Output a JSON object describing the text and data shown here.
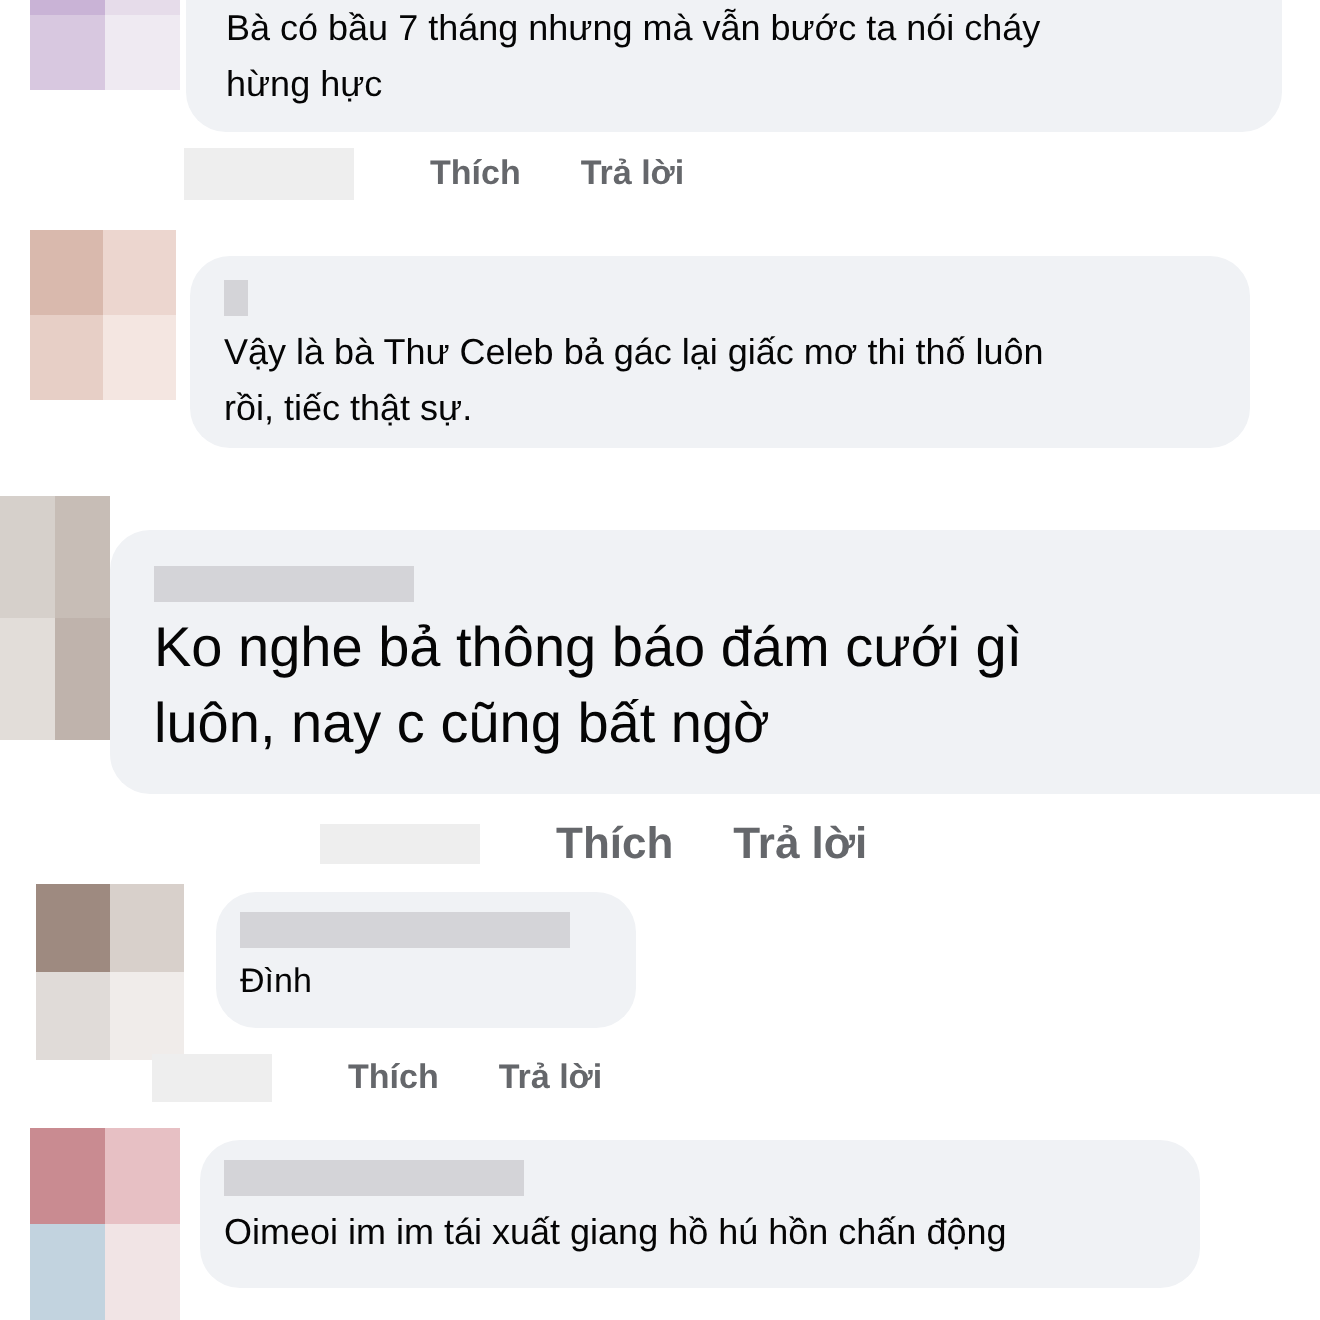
{
  "comments": [
    {
      "text": "Bà có bầu 7 tháng nhưng mà vẫn bước ta  nói cháy hừng hực",
      "actions": [
        "Thích",
        "Trả lời"
      ]
    },
    {
      "text": "Vậy là bà Thư Celeb bả gác lại giấc mơ thi thố luôn rồi, tiếc thật sự."
    },
    {
      "text": "Ko nghe bả thông báo đám cưới gì luôn, nay c cũng bất ngờ",
      "actions": [
        "Thích",
        "Trả lời"
      ]
    },
    {
      "text": "Đình",
      "actions": [
        "Thích",
        "Trả lời"
      ]
    },
    {
      "text": "Oimeoi im im tái xuất giang hồ hú hồn chấn động"
    }
  ]
}
